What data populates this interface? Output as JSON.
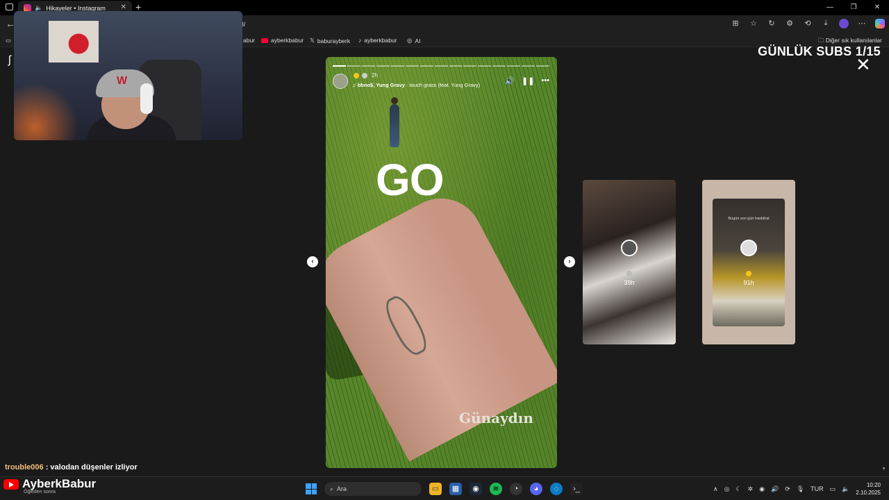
{
  "browser": {
    "tab_title": "Hikayeler • Instagram",
    "url_suffix": "3/",
    "bookmarks": [
      "abur",
      "ayberkbabur",
      "baburayberk",
      "ayberkbabur",
      "AI"
    ],
    "bookmarks_other": "Diğer sık kullanılanlar"
  },
  "overlay": {
    "subs_title": "GÜNLÜK SUBS 1/15"
  },
  "story": {
    "time_ago": "2h",
    "music_artist": "bbno$, Yung Gravy",
    "music_title": " · touch grass (feat. Yung Gravy)",
    "sticker_text": "GO",
    "caption_text": "Günaydın",
    "progress_total": 15,
    "progress_done": 1
  },
  "side_stories": [
    {
      "time": "39h",
      "dot_color": "#bbbbbb"
    },
    {
      "time": "91h",
      "dot_color": "#f5c518",
      "caption": "Bugün son gün hasbihal"
    }
  ],
  "chat": {
    "user": "trouble006",
    "message": " : valodan düşenler izliyor"
  },
  "brand": {
    "name": "AyberkBabur",
    "sub": "Öğleden sonra"
  },
  "taskbar": {
    "search_placeholder": "Ara",
    "language": "TUR",
    "time": "10:20",
    "date": "2.10.2025"
  },
  "colors": {
    "accent_blue": "#3ba3ff",
    "youtube_red": "#ff0000",
    "verified_gold": "#f5c518"
  }
}
